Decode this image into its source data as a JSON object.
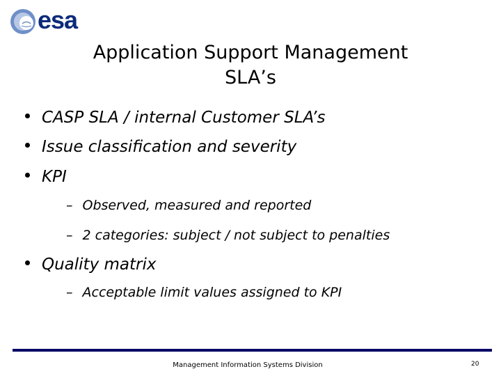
{
  "logo": {
    "text": "esa",
    "color": "#0b2b7a"
  },
  "title": {
    "line1": "Application Support Management",
    "line2": "SLA’s"
  },
  "bullets": [
    {
      "text": "CASP SLA / internal Customer SLA’s"
    },
    {
      "text": "Issue classification and severity"
    },
    {
      "text": "KPI",
      "sub": [
        {
          "text": "Observed, measured and reported"
        },
        {
          "text": "2 categories: subject / not subject to penalties"
        }
      ]
    },
    {
      "text": "Quality matrix",
      "sub": [
        {
          "text": "Acceptable limit values assigned to KPI"
        }
      ]
    }
  ],
  "footer": {
    "text": "Management Information Systems Division",
    "page_number": "20",
    "bar_color": "#000066"
  },
  "dash": "–"
}
